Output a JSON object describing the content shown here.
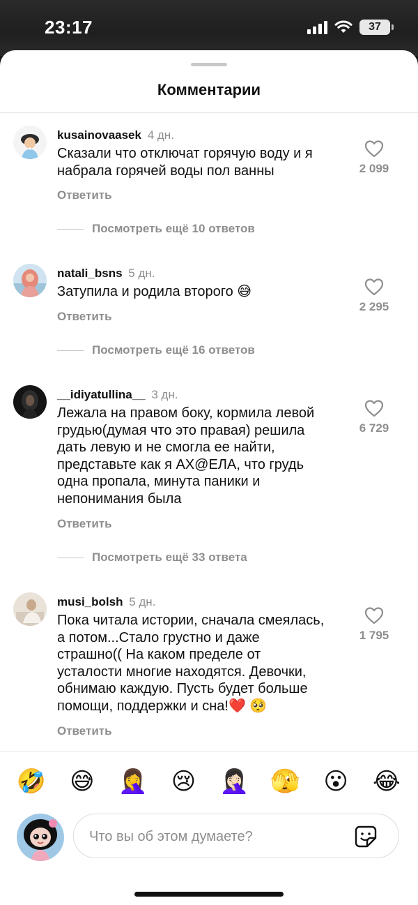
{
  "status": {
    "time": "23:17",
    "battery": "37"
  },
  "title": "Комментарии",
  "comments": [
    {
      "user": "kusainovaasek",
      "time": "4 дн.",
      "lines": [
        "Сказали что отключат горячую воду и я",
        "набрала горячей воды пол ванны"
      ],
      "likes": "2 099",
      "reply": "Ответить",
      "more": "Посмотреть ещё 10 ответов"
    },
    {
      "user": "natali_bsns",
      "time": "5 дн.",
      "lines": [
        "Затупила и родила второго 😅"
      ],
      "likes": "2 295",
      "reply": "Ответить",
      "more": "Посмотреть ещё 16 ответов"
    },
    {
      "user": "__idiyatullina__",
      "time": "3 дн.",
      "lines": [
        "Лежала на правом боку, кормила левой",
        "грудью(думая что это правая) решила",
        "дать левую и не смогла ее найти,",
        "представьте как я АХ@ЕЛА, что грудь",
        "одна пропала, минута паники и",
        "непонимания была"
      ],
      "likes": "6 729",
      "reply": "Ответить",
      "more": "Посмотреть ещё 33 ответа"
    },
    {
      "user": "musi_bolsh",
      "time": "5 дн.",
      "lines": [
        "Пока читала истории, сначала смеялась,",
        "а потом...Стало грустно и даже",
        "страшно(( На каком пределе от",
        "усталости многие находятся. Девочки,",
        "обнимаю каждую. Пусть будет больше",
        "помощи, поддержки и сна!❤️ 🥺"
      ],
      "likes": "1 795",
      "reply": "Ответить"
    }
  ],
  "emojis": [
    "🤣",
    "😅",
    "🤦‍♀️",
    "😢",
    "🤦🏻‍♀️",
    "🫣",
    "😮",
    "😂"
  ],
  "composer": {
    "placeholder": "Что вы об этом думаете?"
  },
  "icons": {
    "like": "heart-icon",
    "sticker": "sticker-icon",
    "wifi": "wifi-icon",
    "signal": "signal-icon",
    "battery": "battery-icon"
  }
}
